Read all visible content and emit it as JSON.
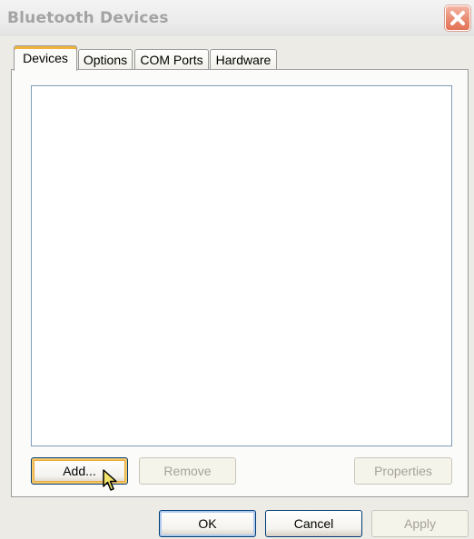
{
  "window": {
    "title": "Bluetooth Devices"
  },
  "tabs": [
    {
      "label": "Devices",
      "active": true
    },
    {
      "label": "Options",
      "active": false
    },
    {
      "label": "COM Ports",
      "active": false
    },
    {
      "label": "Hardware",
      "active": false
    }
  ],
  "device_list": {
    "items": []
  },
  "panel_buttons": {
    "add": "Add...",
    "remove": "Remove",
    "properties": "Properties"
  },
  "dialog_buttons": {
    "ok": "OK",
    "cancel": "Cancel",
    "apply": "Apply"
  },
  "icons": {
    "close": "close-icon",
    "cursor": "pointer-cursor-icon"
  },
  "colors": {
    "close_button": "#e37457",
    "active_tab_highlight": "#f0b33a",
    "disabled_text": "#a5a398"
  }
}
